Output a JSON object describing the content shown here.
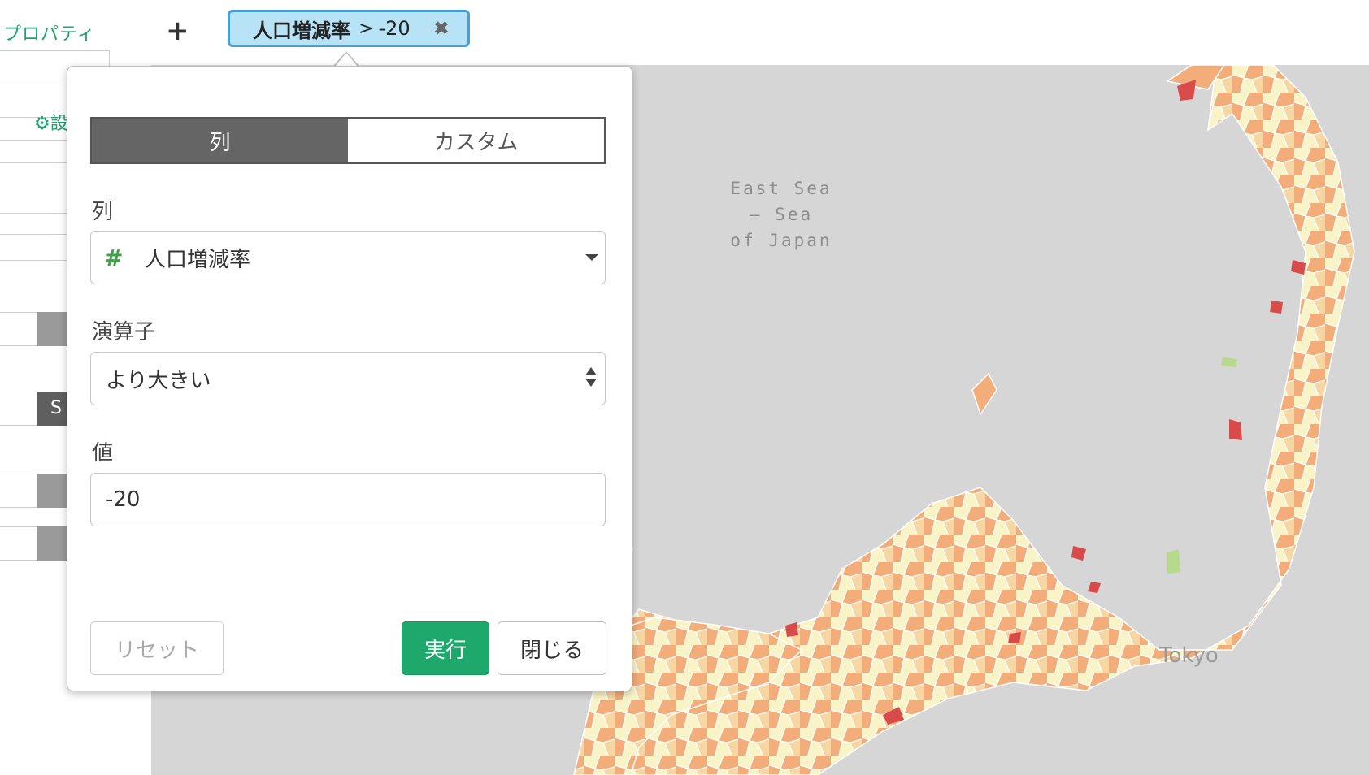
{
  "header": {
    "properties_tab": "プロパティ",
    "add_icon": "plus-icon",
    "filter_chip": {
      "column": "人口増減率",
      "operator": ">",
      "value": "-20",
      "close_icon": "close-icon"
    }
  },
  "left_panel": {
    "gear_icon": "gear-icon",
    "settings_fragment": "設",
    "dark_tab_fragment": "S"
  },
  "map": {
    "sea_label_lines": [
      "East Sea",
      "— Sea",
      "of Japan"
    ],
    "city_label": "Tokyo",
    "colors": {
      "sea": "#d6d6d6",
      "low": "#f9f4c8",
      "mid": "#f2ad7a",
      "high": "#d84b4b",
      "green": "#b7d98b",
      "border": "#ffffff"
    }
  },
  "popover": {
    "tabs": [
      {
        "label": "列",
        "active": true
      },
      {
        "label": "カスタム",
        "active": false
      }
    ],
    "column_label": "列",
    "column_type_icon": "hash-icon",
    "column_value": "人口増減率",
    "operator_label": "演算子",
    "operator_value": "より大きい",
    "value_label": "値",
    "value_input": "-20",
    "buttons": {
      "reset": "リセット",
      "run": "実行",
      "close": "閉じる"
    }
  },
  "accent_color": "#1ea86c"
}
